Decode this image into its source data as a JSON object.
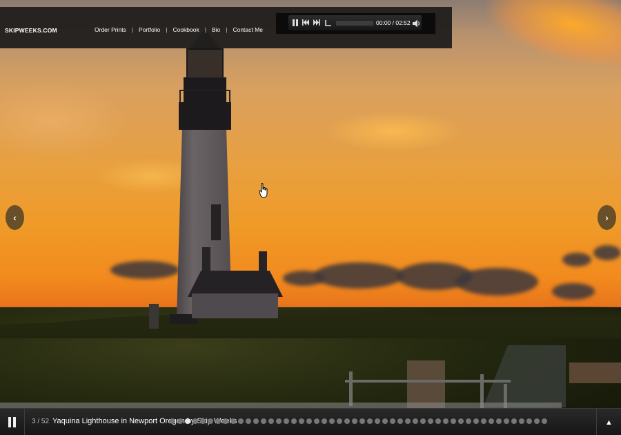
{
  "site": {
    "logo": "SKIPWEEKS.COM"
  },
  "nav": {
    "items": [
      {
        "label": "Order Prints"
      },
      {
        "label": "Portfolio"
      },
      {
        "label": "Cookbook"
      },
      {
        "label": "Bio"
      },
      {
        "label": "Contact Me"
      }
    ],
    "separator": "|"
  },
  "player": {
    "time_display": "00:00 / 02:52",
    "progress": 0.0,
    "icons": [
      "pause-icon",
      "previous-icon",
      "next-icon",
      "repeat-icon",
      "volume-icon"
    ]
  },
  "slideshow": {
    "prev_arrow": "‹",
    "next_arrow": "›",
    "counter": "3 / 52",
    "caption": "Yaquina Lighthouse in Newport Oregon by Skip Weeks",
    "current_index": 3,
    "total": 52,
    "visible_dots": 52,
    "up_arrow": "▲"
  },
  "colors": {
    "navbar_bg": "#22201f",
    "bottombar_bg": "#1e1e1e",
    "sky_orange": "#f09a28"
  }
}
